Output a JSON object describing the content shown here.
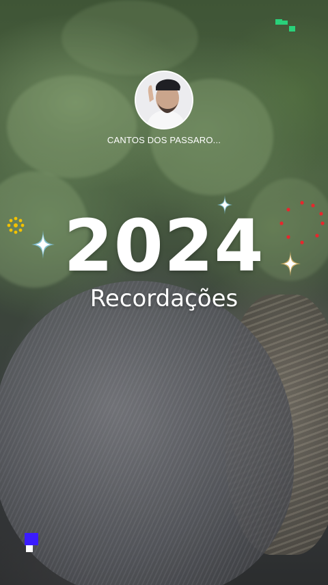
{
  "story": {
    "channel_name": "CANTOS DOS PASSARO...",
    "year": "2024",
    "subtitle": "Recordações"
  },
  "colors": {
    "text": "#ffffff",
    "sparkle_core": "#ffffff",
    "sparkle_glow": "#8ad8ff",
    "dot_red": "#e8262d",
    "flower_yellow": "#f2c200",
    "pixel_green": "#29d17a",
    "pixel_blue": "#3b1cff"
  },
  "icons": {
    "sparkle": "four-point-star",
    "flower": "dotted-ring",
    "corner_top": "green-pixel-blocks",
    "corner_bottom": "blue-pixel-block"
  }
}
